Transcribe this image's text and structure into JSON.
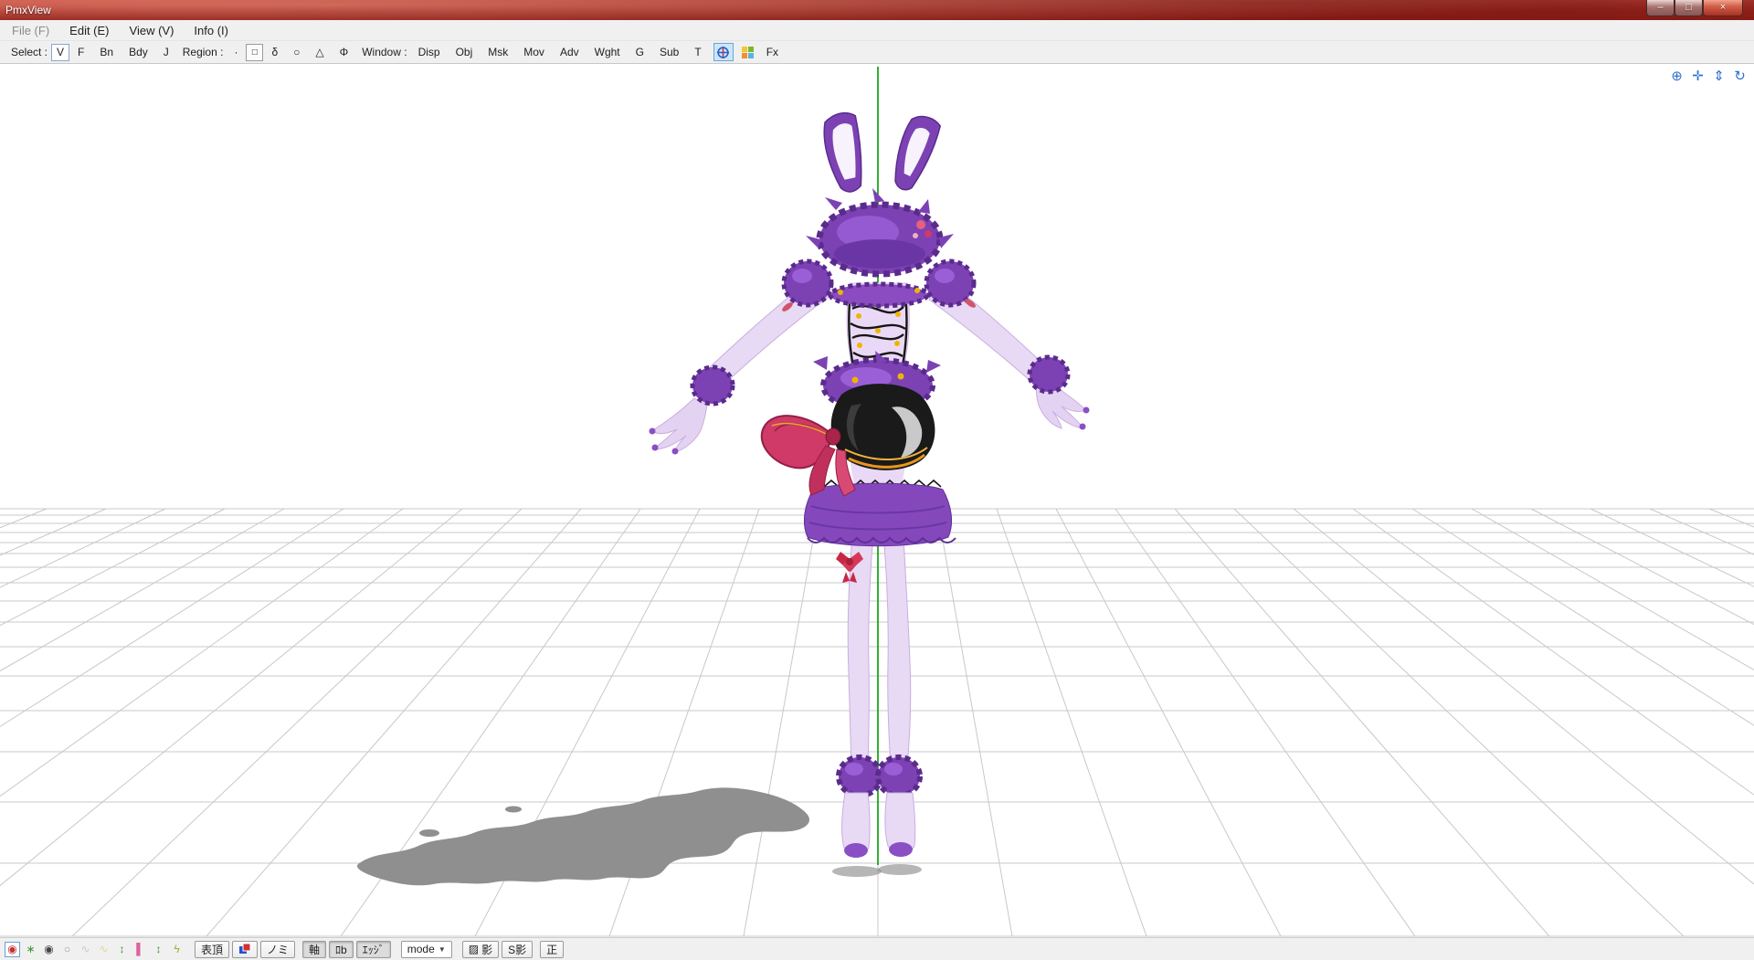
{
  "colors": {
    "titlebar_red": "#9E271E",
    "axis_green": "#009B00",
    "grid_gray": "#C8C8C8",
    "fluff_purple": "#7C42B4",
    "skin_lavender": "#E8D9F5",
    "bow_pink": "#CF3A68",
    "toggle_blue": "#CDE6F7"
  },
  "window": {
    "title": "PmxView",
    "minimize_glyph": "–",
    "maximize_glyph": "□",
    "close_glyph": "×"
  },
  "menu": {
    "items": [
      "File (F)",
      "Edit (E)",
      "View (V)",
      "Info (I)"
    ]
  },
  "toolbar": {
    "select_label": "Select :",
    "select_items": [
      "V",
      "F",
      "Bn",
      "Bdy",
      "J"
    ],
    "region_label": "Region :",
    "region_items": [
      "·",
      "□",
      "δ",
      "○",
      "△",
      "Φ"
    ],
    "window_label": "Window :",
    "window_items": [
      "Disp",
      "Obj",
      "Msk",
      "Mov",
      "Adv",
      "Wght",
      "G",
      "Sub",
      "T"
    ],
    "fx_label": "Fx"
  },
  "viewport": {
    "nav_icons": [
      {
        "name": "pan-view",
        "glyph": "⊕"
      },
      {
        "name": "move-view",
        "glyph": "✛"
      },
      {
        "name": "zoom-view",
        "glyph": "⇕"
      },
      {
        "name": "rotate-view",
        "glyph": "↻"
      }
    ]
  },
  "bottombar": {
    "icons": [
      {
        "name": "camera-target",
        "glyph": "◉"
      },
      {
        "name": "light",
        "glyph": "∗"
      },
      {
        "name": "record",
        "glyph": "◉"
      },
      {
        "name": "circle",
        "glyph": "○"
      },
      {
        "name": "wave-a",
        "glyph": "∿"
      },
      {
        "name": "wave-b",
        "glyph": "∿"
      },
      {
        "name": "updown-a",
        "glyph": "↕"
      },
      {
        "name": "bar",
        "glyph": "▌"
      },
      {
        "name": "updown-b",
        "glyph": "↕"
      },
      {
        "name": "flash",
        "glyph": "ϟ"
      }
    ],
    "btn_front_vertex": "表頂",
    "btn_nomi": "ノミ",
    "btn_axis": "軸",
    "btn_rob": "ﾛb",
    "btn_edge": "ｴｯｼﾞ",
    "mode_label": "mode",
    "dropdown_arrow": "▼",
    "shadow_icon": "▨",
    "btn_shadow": "影",
    "btn_self_shadow": "S影",
    "btn_ortho": "正"
  }
}
